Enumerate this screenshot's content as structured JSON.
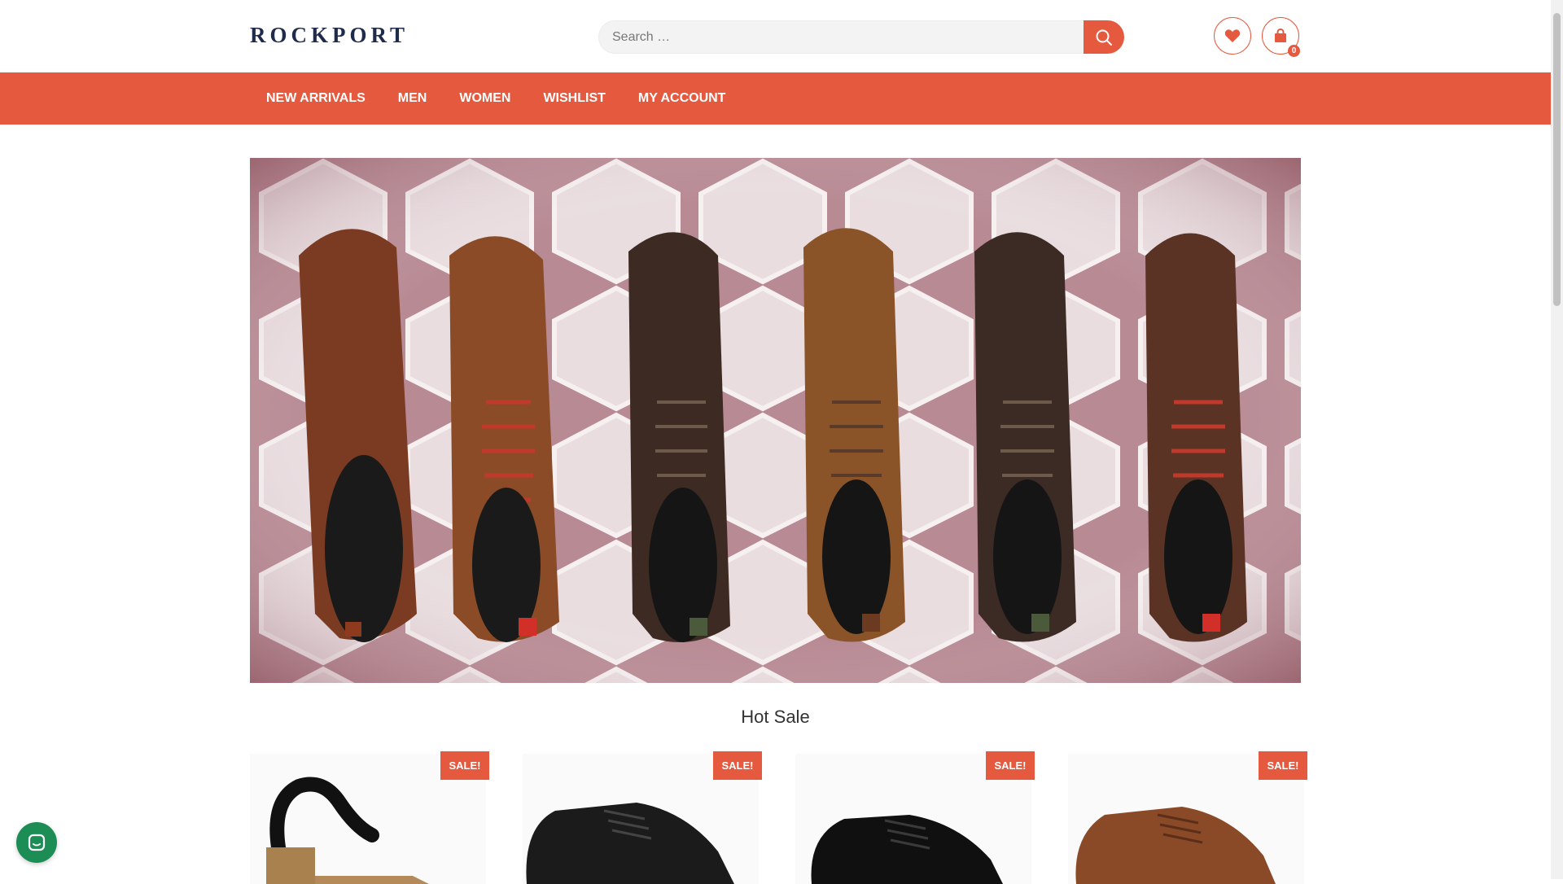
{
  "header": {
    "logo_text": "ROCKPORT",
    "search": {
      "placeholder": "Search …"
    },
    "cart_count": "0"
  },
  "nav": {
    "items": [
      "NEW ARRIVALS",
      "MEN",
      "WOMEN",
      "WISHLIST",
      "MY ACCOUNT"
    ]
  },
  "main": {
    "section_title": "Hot Sale",
    "products": [
      {
        "badge": "SALE!"
      },
      {
        "badge": "SALE!"
      },
      {
        "badge": "SALE!"
      },
      {
        "badge": "SALE!"
      }
    ]
  },
  "colors": {
    "accent": "#e5593e",
    "logo": "#1e2b4a",
    "chat": "#1c8d55"
  },
  "icons": [
    "search-icon",
    "heart-icon",
    "shopping-bag-icon",
    "chat-icon"
  ]
}
